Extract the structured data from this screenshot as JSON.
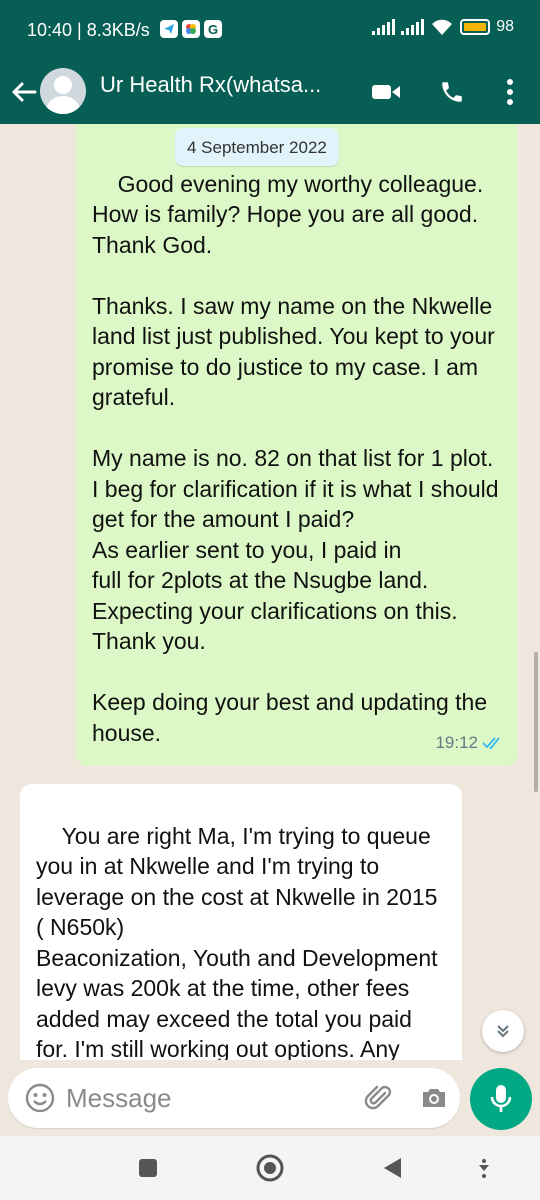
{
  "status_bar": {
    "time_speed": "10:40 | 8.3KB/s",
    "app_icons": [
      "telegram-icon",
      "photos-icon",
      "google-icon"
    ],
    "google_letter": "G",
    "battery": "98"
  },
  "header": {
    "contact_name": "Ur Health Rx(whatsa...",
    "icons": [
      "back-arrow-icon",
      "video-call-icon",
      "phone-call-icon",
      "more-options-icon"
    ]
  },
  "chat": {
    "date_chip": "4 September 2022",
    "messages": [
      {
        "direction": "outgoing",
        "text": "Good evening my worthy colleague.\nHow is family? Hope you are all good. Thank God.\n\nThanks. I saw my name on the Nkwelle land list just published. You kept to your promise to do justice to my case. I am grateful.\n\nMy name is no. 82 on that list for 1 plot.\nI beg for clarification if it is what I should get for the amount I paid?\nAs earlier sent to you, I paid in\nfull for 2plots at the Nsugbe land.\nExpecting your clarifications on this.\nThank you.\n\nKeep doing your best and updating the house.",
        "time": "19:12",
        "status": "read"
      },
      {
        "direction": "incoming",
        "text": "You are right Ma, I'm trying to queue you in at Nkwelle and I'm trying to leverage on the cost at Nkwelle in 2015 ( N650k)\nBeaconization, Youth and Development levy was 200k at the time, other fees added may exceed the total you paid for. I'm still working out options. Any challenges",
        "time": ""
      }
    ]
  },
  "composer": {
    "placeholder": "Message",
    "value": ""
  },
  "colors": {
    "header": "#075e54",
    "outgoing_bubble": "#dcf8c6",
    "incoming_bubble": "#ffffff",
    "wallpaper": "#efe7de",
    "read_ticks": "#34b7f1",
    "mic_button": "#00a884"
  },
  "nav_bar": [
    "recents-square-icon",
    "home-circle-icon",
    "back-triangle-icon",
    "notification-pull-icon"
  ]
}
